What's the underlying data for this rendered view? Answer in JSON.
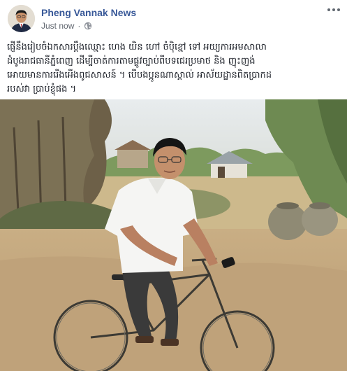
{
  "post": {
    "author": "Pheng Vannak News",
    "timestamp": "Just now",
    "separator": "·",
    "privacy_icon": "globe-icon",
    "more_icon": "more-options-icon",
    "caption_lines": [
      "ផ្ញើនឹងរៀបចំឯកសារប្ដឹងឈ្មោះ ហេង យិន ហៅ ចំប៉ិខ្មៅ ទៅ អយ្យការអមសាលា",
      "ដំបូងរាជធានីភ្នំពេញ ដើម្បីចាត់ការតាមផ្លូវច្បាប់ពីបទជេរប្រមាថ និង ញុះញង់",
      "អោយមានការរើងអើងពូជសាសន៍ ។ បើបងប្អូនណាស្គាល់ អាស័យដ្ឋានពិតប្រាកដ",
      "របស់វា ប្រាប់ខ្ញុំផង ។"
    ]
  },
  "colors": {
    "author_link": "#385898",
    "meta_text": "#616770",
    "body_text": "#1d2129",
    "background": "#ffffff"
  }
}
